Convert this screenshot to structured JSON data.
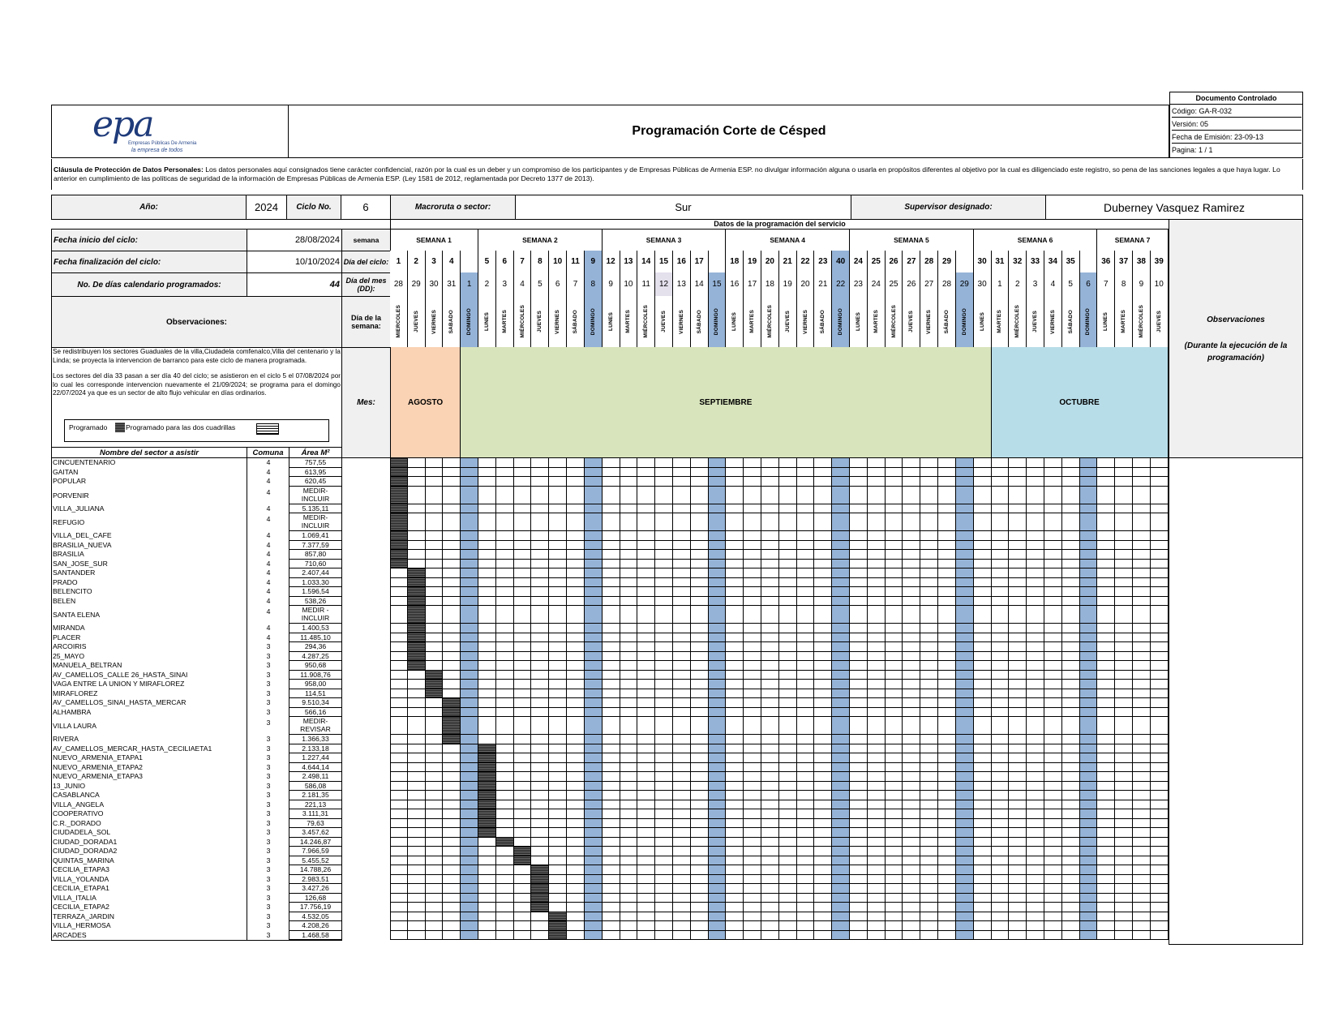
{
  "title": "Programación Corte de Césped",
  "logo": {
    "text": "epa",
    "subtitle1": "Empresas Públicas De Armenia",
    "subtitle2": "la empresa de todos"
  },
  "control": {
    "header": "Documento Controlado",
    "code": "Código: GA-R-032",
    "version": "Versión:  05",
    "date": "Fecha de Emisión:  23-09-13",
    "page": "Pagina:  1 / 1"
  },
  "clause": {
    "label": "Cláusula de Protección de Datos Personales:",
    "text": " Los datos personales aquí consignados tiene carácter confidencial, razón por la cual es un deber y un compromiso de los participantes y de Empresas Públicas de Armenia ESP. no divulgar información alguna o usarla en propósitos diferentes al objetivo por la cual es diligenciado este registro, so pena de las sanciones legales a que haya lugar.  Lo anterior en cumplimiento de las políticas de seguridad de la información de Empresas Públicas de Armenia ESP. (Ley 1581 de 2012, reglamentada por Decreto 1377 de 2013)."
  },
  "info": {
    "year_label": "Año:",
    "year": "2024",
    "cycle_label": "Ciclo No.",
    "cycle": "6",
    "macro_label": "Macroruta o sector:",
    "macro": "Sur",
    "supervisor_label": "Supervisor designado:",
    "supervisor": "Duberney Vasquez Ramirez",
    "datos_header": "Datos de la programación del servicio",
    "start_label": "Fecha inicio del ciclo:",
    "start": "28/08/2024",
    "end_label": "Fecha finalización del ciclo:",
    "end": "10/10/2024",
    "days_label": "No. De días calendario programados:",
    "days": "44",
    "obs_label": "Observaciones:",
    "semana_label": "semana",
    "dia_ciclo_label": "Día del ciclo:",
    "dia_mes_label": "Día del mes (DD):",
    "dia_semana_label": "Día de la semana:",
    "mes_label": "Mes:",
    "obs_right_1": "Observaciones",
    "obs_right_2": "(Durante la ejecución de la programación)"
  },
  "notes": {
    "p1": "Se redistribuyen los sectores Guaduales de la villa,Ciudadela comfenalco,Villa del centenario y la Linda; se proyecta la intervencion de barranco para este ciclo de manera programada.",
    "p2": "Los sectores del día 33 pasan a ser día 40 del ciclo; se asistieron en el ciclo 5 el 07/08/2024 por lo cual les corresponde intervencion nuevamente el 21/09/2024; se programa para el domingo 22/07/2024 ya que es un sector de alto flujo vehicular en días ordinarios.",
    "legend1": "Programado",
    "legend2": "Programado para las dos cuadrillas"
  },
  "table_headers": {
    "name": "Nombre del sector a asistir",
    "comuna": "Comuna",
    "area": "Área M²"
  },
  "weeks": [
    "SEMANA 1",
    "SEMANA 2",
    "SEMANA 3",
    "SEMANA 4",
    "SEMANA 5",
    "SEMANA 6",
    "SEMANA 7"
  ],
  "months": [
    {
      "name": "AGOSTO",
      "color": "#fad3b4"
    },
    {
      "name": "SEPTIEMBRE",
      "color": "#d8e4bc"
    },
    {
      "name": "OCTUBRE",
      "color": "#b7dde8"
    }
  ],
  "cycle_days": [
    "1",
    "2",
    "3",
    "4",
    "",
    "5",
    "6",
    "7",
    "8",
    "10",
    "11",
    "9",
    "12",
    "13",
    "14",
    "15",
    "16",
    "17",
    "",
    "18",
    "19",
    "20",
    "21",
    "22",
    "23",
    "40",
    "24",
    "25",
    "26",
    "27",
    "28",
    "29",
    "",
    "30",
    "31",
    "32",
    "33",
    "34",
    "35",
    "",
    "36",
    "37",
    "38",
    "39"
  ],
  "month_days": [
    "28",
    "29",
    "30",
    "31",
    "1",
    "2",
    "3",
    "4",
    "5",
    "6",
    "7",
    "8",
    "9",
    "10",
    "11",
    "12",
    "13",
    "14",
    "15",
    "16",
    "17",
    "18",
    "19",
    "20",
    "21",
    "22",
    "23",
    "24",
    "25",
    "26",
    "27",
    "28",
    "29",
    "30",
    "1",
    "2",
    "3",
    "4",
    "5",
    "6",
    "7",
    "8",
    "9",
    "10"
  ],
  "weekdays": [
    "MIERCOLES",
    "JUEVES",
    "VIERNES",
    "SABADO",
    "DOMINGO",
    "LUNES",
    "MARTES",
    "MIÉRCOLES",
    "JUEVES",
    "VIERNES",
    "SÁBADO",
    "DOMINGO",
    "LUNES",
    "MARTES",
    "MIÉRCOLES",
    "JUEVES",
    "VIERNES",
    "SÁBADO",
    "DOMINGO",
    "LUNES",
    "MARTES",
    "MIÉRCOLES",
    "JUEVES",
    "VIERNES",
    "SÁBADO",
    "DOMINGO",
    "LUNES",
    "MARTES",
    "MIÉRCOLES",
    "JUEVES",
    "VIERNES",
    "SÁBADO",
    "DOMINGO",
    "LUNES",
    "MARTES",
    "MIÉRCOLES",
    "JUEVES",
    "VIERNES",
    "SÁBADO",
    "DOMINGO",
    "LUNES",
    "MARTES",
    "MIÉRCOLES",
    "JUEVES"
  ],
  "sectors": [
    {
      "name": "CINCUENTENARIO",
      "comuna": "4",
      "area": "757,55",
      "day": 0
    },
    {
      "name": "GAITAN",
      "comuna": "4",
      "area": "613,95",
      "day": 0
    },
    {
      "name": "POPULAR",
      "comuna": "4",
      "area": "620,45",
      "day": 0
    },
    {
      "name": "PORVENIR",
      "comuna": "4",
      "area": "MEDIR-INCLUIR",
      "day": 0,
      "tall": true
    },
    {
      "name": "VILLA_JULIANA",
      "comuna": "4",
      "area": "5.135,11",
      "day": 0
    },
    {
      "name": "REFUGIO",
      "comuna": "4",
      "area": "MEDIR-INCLUIR",
      "day": 0,
      "tall": true
    },
    {
      "name": "VILLA_DEL_CAFE",
      "comuna": "4",
      "area": "1.069,41",
      "day": 0
    },
    {
      "name": "BRASILIA_NUEVA",
      "comuna": "4",
      "area": "7.377,59",
      "day": 0
    },
    {
      "name": "BRASILIA",
      "comuna": "4",
      "area": "857,80",
      "day": 0
    },
    {
      "name": "SAN_JOSE_SUR",
      "comuna": "4",
      "area": "710,60",
      "day": 0
    },
    {
      "name": "SANTANDER",
      "comuna": "4",
      "area": "2.407,44",
      "day": 1
    },
    {
      "name": "PRADO",
      "comuna": "4",
      "area": "1.033,30",
      "day": 1
    },
    {
      "name": "BELENCITO",
      "comuna": "4",
      "area": "1.596,54",
      "day": 1
    },
    {
      "name": "BELEN",
      "comuna": "4",
      "area": "538,26",
      "day": 1
    },
    {
      "name": "SANTA ELENA",
      "comuna": "4",
      "area": "MEDIR - INCLUIR",
      "day": 1,
      "tall": true
    },
    {
      "name": "MIRANDA",
      "comuna": "4",
      "area": "1.400,53",
      "day": 1
    },
    {
      "name": "PLACER",
      "comuna": "4",
      "area": "11.485,10",
      "day": 1
    },
    {
      "name": "ARCOIRIS",
      "comuna": "3",
      "area": "294,36",
      "day": 1
    },
    {
      "name": "25_MAYO",
      "comuna": "3",
      "area": "4.287,25",
      "day": 1
    },
    {
      "name": "MANUELA_BELTRAN",
      "comuna": "3",
      "area": "950,68",
      "day": 1
    },
    {
      "name": "AV_CAMELLOS_CALLE 26_HASTA_SINAI",
      "comuna": "3",
      "area": "11.908,76",
      "day": 2
    },
    {
      "name": "VAGA ENTRE LA UNION Y MIRAFLOREZ",
      "comuna": "3",
      "area": "958,00",
      "day": 2
    },
    {
      "name": "MIRAFLOREZ",
      "comuna": "3",
      "area": "114,51",
      "day": 2
    },
    {
      "name": "AV_CAMELLOS_SINAI_HASTA_MERCAR",
      "comuna": "3",
      "area": "9.510,34",
      "day": 3
    },
    {
      "name": "ALHAMBRA",
      "comuna": "3",
      "area": "566,16",
      "day": 3
    },
    {
      "name": "VILLA LAURA",
      "comuna": "3",
      "area": "MEDIR-REVISAR",
      "day": 3,
      "tall": true
    },
    {
      "name": "RIVERA",
      "comuna": "3",
      "area": "1.366,33",
      "day": 3
    },
    {
      "name": "AV_CAMELLOS_MERCAR_HASTA_CECILIAETA1",
      "comuna": "3",
      "area": "2.133,18",
      "day": 5
    },
    {
      "name": "NUEVO_ARMENIA_ETAPA1",
      "comuna": "3",
      "area": "1.227,44",
      "day": 5
    },
    {
      "name": "NUEVO_ARMENIA_ETAPA2",
      "comuna": "3",
      "area": "4.644,14",
      "day": 5
    },
    {
      "name": "NUEVO_ARMENIA_ETAPA3",
      "comuna": "3",
      "area": "2.498,11",
      "day": 5
    },
    {
      "name": "13_JUNIO",
      "comuna": "3",
      "area": "586,08",
      "day": 5
    },
    {
      "name": "CASABLANCA",
      "comuna": "3",
      "area": "2.181,35",
      "day": 5
    },
    {
      "name": "VILLA_ANGELA",
      "comuna": "3",
      "area": "221,13",
      "day": 5
    },
    {
      "name": "COOPERATIVO",
      "comuna": "3",
      "area": "3.111,31",
      "day": 5
    },
    {
      "name": "C.R._DORADO",
      "comuna": "3",
      "area": "79,63",
      "day": 5
    },
    {
      "name": "CIUDADELA_SOL",
      "comuna": "3",
      "area": "3.457,62",
      "day": 5
    },
    {
      "name": "CIUDAD_DORADA1",
      "comuna": "3",
      "area": "14.246,87",
      "day": 6
    },
    {
      "name": "CIUDAD_DORADA2",
      "comuna": "3",
      "area": "7.966,59",
      "day": 7
    },
    {
      "name": "QUINTAS_MARINA",
      "comuna": "3",
      "area": "5.455,52",
      "day": 7
    },
    {
      "name": "CECILIA_ETAPA3",
      "comuna": "3",
      "area": "14.788,26",
      "day": 8
    },
    {
      "name": "VILLA_YOLANDA",
      "comuna": "3",
      "area": "2.983,51",
      "day": 8
    },
    {
      "name": "CECILIA_ETAPA1",
      "comuna": "3",
      "area": "3.427,26",
      "day": 8
    },
    {
      "name": "VILLA_ITALIA",
      "comuna": "3",
      "area": "126,68",
      "day": 8
    },
    {
      "name": "CECILIA_ETAPA2",
      "comuna": "3",
      "area": "17.756,19",
      "day": 8
    },
    {
      "name": "TERRAZA_JARDIN",
      "comuna": "3",
      "area": "4.532,05",
      "day": 9
    },
    {
      "name": "VILLA_HERMOSA",
      "comuna": "3",
      "area": "4.208,26",
      "day": 9
    },
    {
      "name": "ARCADES",
      "comuna": "3",
      "area": "1.468,58",
      "day": 9
    }
  ]
}
